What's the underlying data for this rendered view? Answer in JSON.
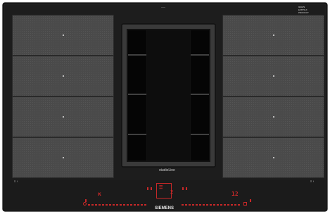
{
  "appliance": {
    "top_label": "——",
    "corner_labels": [
      "9000/9",
      "EX875LX",
      "PRODUCT"
    ],
    "center_label": "studioLine",
    "brand": "SIEMENS"
  },
  "left_zones": [
    {
      "name": "left-zone-1"
    },
    {
      "name": "left-zone-2"
    },
    {
      "name": "left-zone-3"
    },
    {
      "name": "left-zone-4"
    }
  ],
  "right_zones": [
    {
      "name": "right-zone-1"
    },
    {
      "name": "right-zone-2"
    },
    {
      "name": "right-zone-3"
    },
    {
      "name": "right-zone-4"
    }
  ],
  "controls": {
    "left_readout": "ĸ",
    "right_readout": "12",
    "left_power_marks": "≡ ↑",
    "right_power_marks": "≡ ↑",
    "center_level": "2",
    "center_marks": "☰"
  },
  "colors": {
    "glass": "#1e1e1e",
    "zone": "#4a4a4a",
    "accent_red": "#c62828"
  }
}
